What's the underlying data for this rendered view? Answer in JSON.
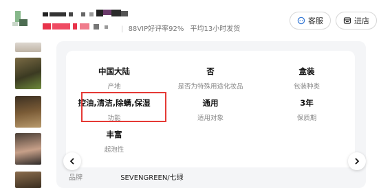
{
  "header": {
    "rating_text": "88VIP好评率92%",
    "shipping_text": "平均13小时发货",
    "service_button": "客服",
    "store_button": "进店"
  },
  "attributes": [
    {
      "value": "中国大陆",
      "label": "产地"
    },
    {
      "value": "否",
      "label": "是否为特殊用途化妆品"
    },
    {
      "value": "盒装",
      "label": "包装种类"
    },
    {
      "value": "控油,清洁,除螨,保湿",
      "label": "功能"
    },
    {
      "value": "通用",
      "label": "适用对象"
    },
    {
      "value": "3年",
      "label": "保质期"
    },
    {
      "value": "丰富",
      "label": "起泡性"
    }
  ],
  "brand": {
    "key": "品牌",
    "value": "SEVENGREEN/七绿"
  },
  "colors": {
    "highlight": "#e53935",
    "panel_bg": "#f4f5f7",
    "service_icon": "#3a7bd5"
  },
  "icons": {
    "service": "headset-icon",
    "store": "store-icon",
    "prev": "chevron-left-icon",
    "next": "chevron-right-icon"
  }
}
